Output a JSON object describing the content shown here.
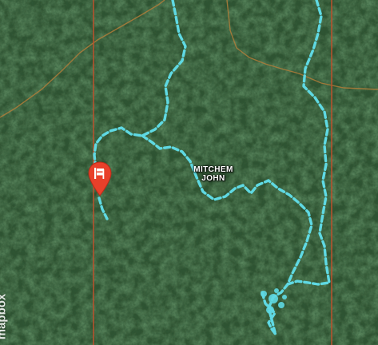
{
  "map": {
    "style": "satellite",
    "colors": {
      "forest_base": "#203a22",
      "trail": "#5fd9e3",
      "boundary_line": "#b5522e",
      "contour_line": "#b07c3a",
      "marker": "#e8402a"
    }
  },
  "place_label": {
    "line1": "MITCHEM",
    "line2": "JOHN"
  },
  "marker": {
    "icon": "trailhead-icon",
    "color": "#e8402a"
  },
  "attribution": {
    "text": "mapbox"
  }
}
